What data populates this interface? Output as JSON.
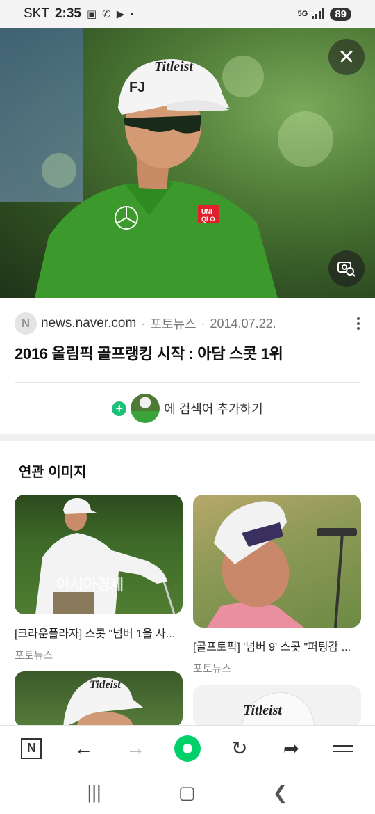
{
  "status_bar": {
    "carrier": "SKT",
    "time": "2:35",
    "network": "5G",
    "battery": "89"
  },
  "hero": {
    "close_icon": "close-icon",
    "lens_icon": "image-search-icon"
  },
  "result": {
    "favicon_letter": "N",
    "domain": "news.naver.com",
    "category": "포토뉴스",
    "date": "2014.07.22.",
    "headline": "2016 올림픽 골프랭킹 시작 : 아담 스콧 1위",
    "add_search_label": "에 검색어 추가하기"
  },
  "related": {
    "title": "연관 이미지",
    "items": [
      {
        "title": "[크라운플라자] 스콧 \"넘버 1을 사...",
        "source": "포토뉴스",
        "watermark": "아시아경제"
      },
      {
        "title": "[골프토픽] '넘버 9' 스콧 \"퍼팅감 ...",
        "source": "포토뉴스"
      },
      {
        "title": "",
        "source": ""
      },
      {
        "title": "",
        "source": ""
      }
    ]
  },
  "bottom_nav": {
    "home_letter": "N",
    "icons": [
      "naver-home-icon",
      "back-icon",
      "forward-icon",
      "green-dot-icon",
      "refresh-icon",
      "share-icon",
      "menu-icon"
    ]
  },
  "system_nav": {
    "icons": [
      "recent-apps-icon",
      "home-icon",
      "back-icon"
    ]
  }
}
